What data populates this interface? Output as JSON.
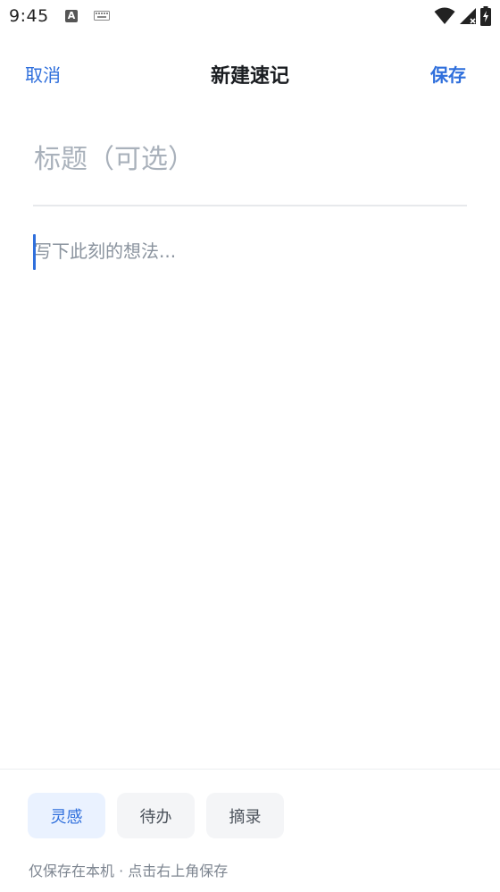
{
  "status_bar": {
    "time": "9:45",
    "left_icons": [
      "a-notification-icon",
      "keyboard-icon"
    ],
    "right_icons": [
      "wifi-icon",
      "signal-icon",
      "battery-charging-icon"
    ]
  },
  "header": {
    "cancel_label": "取消",
    "title": "新建速记",
    "save_label": "保存",
    "accent_color": "#2f6fdc"
  },
  "editor": {
    "title_placeholder": "标题（可选）",
    "title_value": "",
    "body_placeholder": "写下此刻的想法...",
    "body_value": ""
  },
  "tags": {
    "items": [
      {
        "label": "灵感",
        "active": true
      },
      {
        "label": "待办",
        "active": false
      },
      {
        "label": "摘录",
        "active": false
      }
    ]
  },
  "footer": {
    "note": "仅保存在本机 · 点击右上角保存"
  }
}
